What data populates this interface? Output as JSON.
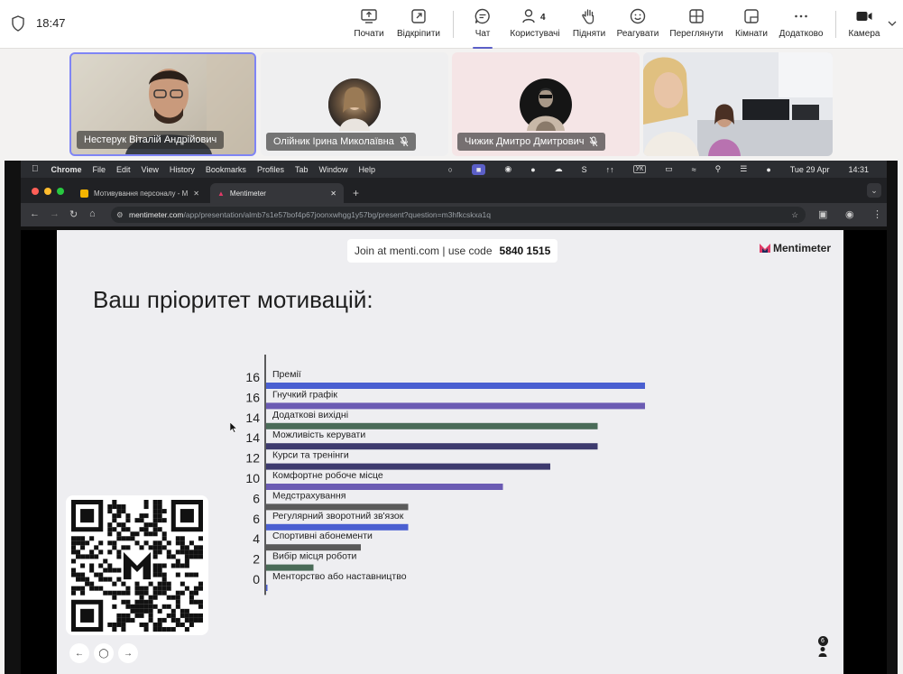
{
  "teams": {
    "time": "18:47",
    "toolbar": [
      {
        "id": "share",
        "label": "Почати",
        "icon": "share-screen-icon"
      },
      {
        "id": "popout",
        "label": "Відкріпити",
        "icon": "pop-out-icon"
      },
      {
        "id": "chat",
        "label": "Чат",
        "icon": "chat-icon",
        "active": true
      },
      {
        "id": "people",
        "label": "Користувачі",
        "icon": "people-icon",
        "count": "4"
      },
      {
        "id": "raise",
        "label": "Підняти",
        "icon": "raise-hand-icon"
      },
      {
        "id": "react",
        "label": "Реагувати",
        "icon": "react-icon"
      },
      {
        "id": "view",
        "label": "Переглянути",
        "icon": "view-grid-icon"
      },
      {
        "id": "rooms",
        "label": "Кімнати",
        "icon": "rooms-icon"
      },
      {
        "id": "more",
        "label": "Додатково",
        "icon": "more-icon"
      },
      {
        "id": "camera",
        "label": "Камера",
        "icon": "camera-icon"
      }
    ],
    "participants": [
      {
        "name": "Нестерук Віталій Андрійович",
        "muted": false
      },
      {
        "name": "Олійник Ірина Миколаївна",
        "muted": true
      },
      {
        "name": "Чижик Дмитро Дмитрович",
        "muted": true
      },
      {
        "name": "",
        "muted": false
      }
    ]
  },
  "mac_menu": [
    "Chrome",
    "File",
    "Edit",
    "View",
    "History",
    "Bookmarks",
    "Profiles",
    "Tab",
    "Window",
    "Help"
  ],
  "mac_status": {
    "date": "Tue 29 Apr",
    "time": "14:31",
    "lang": "УК"
  },
  "browser": {
    "tabs": [
      {
        "title": "Мотивування персоналу - М",
        "active": false
      },
      {
        "title": "Mentimeter",
        "active": true
      }
    ],
    "url_host": "mentimeter.com",
    "url_path": "/app/presentation/almb7s1e57bof4p67joonxwhgg1y57bg/present?question=m3hfkcskxa1q"
  },
  "slide": {
    "join_text": "Join at menti.com | use code",
    "join_code": "5840 1515",
    "brand": "Mentimeter",
    "title": "Ваш пріоритет мотивацій:",
    "participants_count": "6"
  },
  "chart_data": {
    "type": "bar",
    "orientation": "horizontal",
    "categories": [
      "Премії",
      "Гнучкий графік",
      "Додаткові вихідні",
      "Можливість керувати",
      "Курси та тренінги",
      "Комфортне робоче місце",
      "Медстрахування",
      "Регулярний зворотний зв'язок",
      "Спортивні абонементи",
      "Вибір місця роботи",
      "Менторство або наставництво"
    ],
    "values": [
      16,
      16,
      14,
      14,
      12,
      10,
      6,
      6,
      4,
      2,
      0
    ],
    "colors": [
      "#4a5fd1",
      "#6b5bb3",
      "#4a6b58",
      "#3d3a6e",
      "#3d3a6e",
      "#6b5bb3",
      "#5a5a5a",
      "#4a5fd1",
      "#5a5a5a",
      "#4a6b58",
      "#4a5fd1"
    ],
    "xlim": [
      0,
      16
    ]
  }
}
